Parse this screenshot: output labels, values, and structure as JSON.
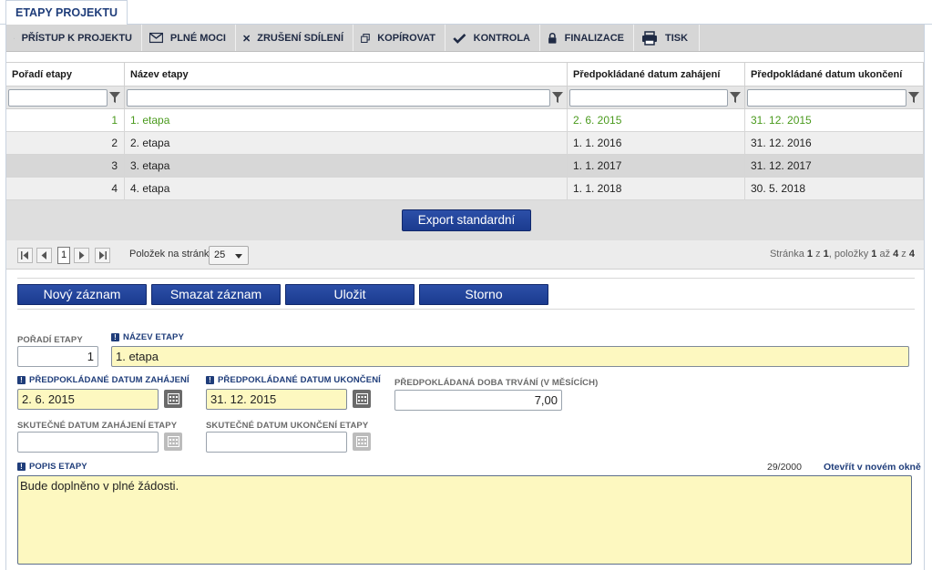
{
  "tab": {
    "label": "ETAPY PROJEKTU"
  },
  "toolbar": {
    "items": [
      {
        "label": "PŘÍSTUP K PROJEKTU",
        "icon": "people-icon"
      },
      {
        "label": "PLNÉ MOCI",
        "icon": "envelope-icon"
      },
      {
        "label": "ZRUŠENÍ SDÍLENÍ",
        "icon": "x-icon"
      },
      {
        "label": "KOPÍROVAT",
        "icon": "copy-icon"
      },
      {
        "label": "KONTROLA",
        "icon": "check-icon"
      },
      {
        "label": "FINALIZACE",
        "icon": "lock-icon"
      },
      {
        "label": "TISK",
        "icon": "printer-icon"
      }
    ]
  },
  "grid": {
    "columns": [
      "Pořadí etapy",
      "Název etapy",
      "Předpokládané datum zahájení",
      "Předpokládané datum ukončení"
    ],
    "rows": [
      [
        "1",
        "1. etapa",
        "2. 6. 2015",
        "31. 12. 2015"
      ],
      [
        "2",
        "2. etapa",
        "1. 1. 2016",
        "31. 12. 2016"
      ],
      [
        "3",
        "3. etapa",
        "1. 1. 2017",
        "31. 12. 2017"
      ],
      [
        "4",
        "4. etapa",
        "1. 1. 2018",
        "30. 5. 2018"
      ]
    ],
    "selected_row_color": "#4a9a1d",
    "export_label": "Export standardní"
  },
  "pager": {
    "current_page": "1",
    "per_page_label": "Položek na stránku",
    "per_page_value": "25",
    "info_prefix": "Stránka ",
    "page": "1",
    "of": " z ",
    "pages": "1",
    "items_label": ", položky ",
    "from": "1",
    "to_label": " až ",
    "to": "4",
    "z2": " z ",
    "total": "4"
  },
  "actions": {
    "new": "Nový záznam",
    "delete": "Smazat záznam",
    "save": "Uložit",
    "cancel": "Storno"
  },
  "form": {
    "order_label": "POŘADÍ ETAPY",
    "order_value": "1",
    "name_label": "NÁZEV ETAPY",
    "name_value": "1. etapa",
    "start_label": "PŘEDPOKLÁDANÉ DATUM ZAHÁJENÍ",
    "start_value": "2. 6. 2015",
    "end_label": "PŘEDPOKLÁDANÉ DATUM UKONČENÍ",
    "end_value": "31. 12. 2015",
    "duration_label": "PŘEDPOKLÁDANÁ DOBA TRVÁNÍ (V MĚSÍCÍCH)",
    "duration_value": "7,00",
    "actual_start_label": "SKUTEČNÉ DATUM ZAHÁJENÍ ETAPY",
    "actual_start_value": "",
    "actual_end_label": "SKUTEČNÉ DATUM UKONČENÍ ETAPY",
    "actual_end_value": "",
    "desc_label": "POPIS ETAPY",
    "desc_counter": "29/2000",
    "desc_open_link": "Otevřít v novém okně",
    "desc_value": "Bude doplněno v plné žádosti."
  },
  "colors": {
    "button_blue": "#1b3b8f",
    "required_yellow": "#fdf8c0",
    "title_blue": "#1f3d7a"
  }
}
